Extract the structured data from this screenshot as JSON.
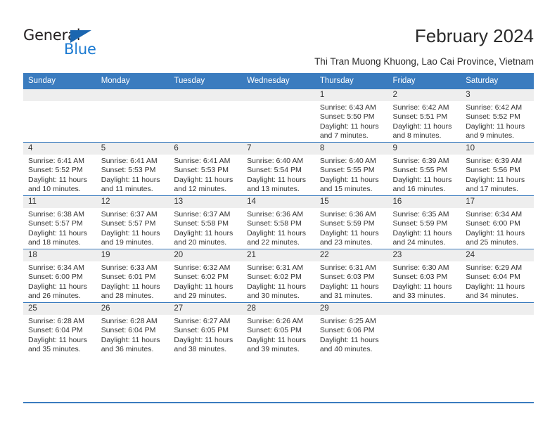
{
  "brand": {
    "name_part1": "General",
    "name_part2": "Blue",
    "triangle_color": "#1b66b0",
    "blue_color": "#1b7ad1"
  },
  "header": {
    "title": "February 2024",
    "subtitle": "Thi Tran Muong Khuong, Lao Cai Province, Vietnam"
  },
  "theme": {
    "header_bar": "#3b7cbf",
    "daynum_shade": "#eeeeee",
    "text": "#333333"
  },
  "weekdays": [
    "Sunday",
    "Monday",
    "Tuesday",
    "Wednesday",
    "Thursday",
    "Friday",
    "Saturday"
  ],
  "weeks": [
    [
      {
        "day": "",
        "sunrise": "",
        "sunset": "",
        "daylight1": "",
        "daylight2": ""
      },
      {
        "day": "",
        "sunrise": "",
        "sunset": "",
        "daylight1": "",
        "daylight2": ""
      },
      {
        "day": "",
        "sunrise": "",
        "sunset": "",
        "daylight1": "",
        "daylight2": ""
      },
      {
        "day": "",
        "sunrise": "",
        "sunset": "",
        "daylight1": "",
        "daylight2": ""
      },
      {
        "day": "1",
        "sunrise": "Sunrise: 6:43 AM",
        "sunset": "Sunset: 5:50 PM",
        "daylight1": "Daylight: 11 hours",
        "daylight2": "and 7 minutes."
      },
      {
        "day": "2",
        "sunrise": "Sunrise: 6:42 AM",
        "sunset": "Sunset: 5:51 PM",
        "daylight1": "Daylight: 11 hours",
        "daylight2": "and 8 minutes."
      },
      {
        "day": "3",
        "sunrise": "Sunrise: 6:42 AM",
        "sunset": "Sunset: 5:52 PM",
        "daylight1": "Daylight: 11 hours",
        "daylight2": "and 9 minutes."
      }
    ],
    [
      {
        "day": "4",
        "sunrise": "Sunrise: 6:41 AM",
        "sunset": "Sunset: 5:52 PM",
        "daylight1": "Daylight: 11 hours",
        "daylight2": "and 10 minutes."
      },
      {
        "day": "5",
        "sunrise": "Sunrise: 6:41 AM",
        "sunset": "Sunset: 5:53 PM",
        "daylight1": "Daylight: 11 hours",
        "daylight2": "and 11 minutes."
      },
      {
        "day": "6",
        "sunrise": "Sunrise: 6:41 AM",
        "sunset": "Sunset: 5:53 PM",
        "daylight1": "Daylight: 11 hours",
        "daylight2": "and 12 minutes."
      },
      {
        "day": "7",
        "sunrise": "Sunrise: 6:40 AM",
        "sunset": "Sunset: 5:54 PM",
        "daylight1": "Daylight: 11 hours",
        "daylight2": "and 13 minutes."
      },
      {
        "day": "8",
        "sunrise": "Sunrise: 6:40 AM",
        "sunset": "Sunset: 5:55 PM",
        "daylight1": "Daylight: 11 hours",
        "daylight2": "and 15 minutes."
      },
      {
        "day": "9",
        "sunrise": "Sunrise: 6:39 AM",
        "sunset": "Sunset: 5:55 PM",
        "daylight1": "Daylight: 11 hours",
        "daylight2": "and 16 minutes."
      },
      {
        "day": "10",
        "sunrise": "Sunrise: 6:39 AM",
        "sunset": "Sunset: 5:56 PM",
        "daylight1": "Daylight: 11 hours",
        "daylight2": "and 17 minutes."
      }
    ],
    [
      {
        "day": "11",
        "sunrise": "Sunrise: 6:38 AM",
        "sunset": "Sunset: 5:57 PM",
        "daylight1": "Daylight: 11 hours",
        "daylight2": "and 18 minutes."
      },
      {
        "day": "12",
        "sunrise": "Sunrise: 6:37 AM",
        "sunset": "Sunset: 5:57 PM",
        "daylight1": "Daylight: 11 hours",
        "daylight2": "and 19 minutes."
      },
      {
        "day": "13",
        "sunrise": "Sunrise: 6:37 AM",
        "sunset": "Sunset: 5:58 PM",
        "daylight1": "Daylight: 11 hours",
        "daylight2": "and 20 minutes."
      },
      {
        "day": "14",
        "sunrise": "Sunrise: 6:36 AM",
        "sunset": "Sunset: 5:58 PM",
        "daylight1": "Daylight: 11 hours",
        "daylight2": "and 22 minutes."
      },
      {
        "day": "15",
        "sunrise": "Sunrise: 6:36 AM",
        "sunset": "Sunset: 5:59 PM",
        "daylight1": "Daylight: 11 hours",
        "daylight2": "and 23 minutes."
      },
      {
        "day": "16",
        "sunrise": "Sunrise: 6:35 AM",
        "sunset": "Sunset: 5:59 PM",
        "daylight1": "Daylight: 11 hours",
        "daylight2": "and 24 minutes."
      },
      {
        "day": "17",
        "sunrise": "Sunrise: 6:34 AM",
        "sunset": "Sunset: 6:00 PM",
        "daylight1": "Daylight: 11 hours",
        "daylight2": "and 25 minutes."
      }
    ],
    [
      {
        "day": "18",
        "sunrise": "Sunrise: 6:34 AM",
        "sunset": "Sunset: 6:00 PM",
        "daylight1": "Daylight: 11 hours",
        "daylight2": "and 26 minutes."
      },
      {
        "day": "19",
        "sunrise": "Sunrise: 6:33 AM",
        "sunset": "Sunset: 6:01 PM",
        "daylight1": "Daylight: 11 hours",
        "daylight2": "and 28 minutes."
      },
      {
        "day": "20",
        "sunrise": "Sunrise: 6:32 AM",
        "sunset": "Sunset: 6:02 PM",
        "daylight1": "Daylight: 11 hours",
        "daylight2": "and 29 minutes."
      },
      {
        "day": "21",
        "sunrise": "Sunrise: 6:31 AM",
        "sunset": "Sunset: 6:02 PM",
        "daylight1": "Daylight: 11 hours",
        "daylight2": "and 30 minutes."
      },
      {
        "day": "22",
        "sunrise": "Sunrise: 6:31 AM",
        "sunset": "Sunset: 6:03 PM",
        "daylight1": "Daylight: 11 hours",
        "daylight2": "and 31 minutes."
      },
      {
        "day": "23",
        "sunrise": "Sunrise: 6:30 AM",
        "sunset": "Sunset: 6:03 PM",
        "daylight1": "Daylight: 11 hours",
        "daylight2": "and 33 minutes."
      },
      {
        "day": "24",
        "sunrise": "Sunrise: 6:29 AM",
        "sunset": "Sunset: 6:04 PM",
        "daylight1": "Daylight: 11 hours",
        "daylight2": "and 34 minutes."
      }
    ],
    [
      {
        "day": "25",
        "sunrise": "Sunrise: 6:28 AM",
        "sunset": "Sunset: 6:04 PM",
        "daylight1": "Daylight: 11 hours",
        "daylight2": "and 35 minutes."
      },
      {
        "day": "26",
        "sunrise": "Sunrise: 6:28 AM",
        "sunset": "Sunset: 6:04 PM",
        "daylight1": "Daylight: 11 hours",
        "daylight2": "and 36 minutes."
      },
      {
        "day": "27",
        "sunrise": "Sunrise: 6:27 AM",
        "sunset": "Sunset: 6:05 PM",
        "daylight1": "Daylight: 11 hours",
        "daylight2": "and 38 minutes."
      },
      {
        "day": "28",
        "sunrise": "Sunrise: 6:26 AM",
        "sunset": "Sunset: 6:05 PM",
        "daylight1": "Daylight: 11 hours",
        "daylight2": "and 39 minutes."
      },
      {
        "day": "29",
        "sunrise": "Sunrise: 6:25 AM",
        "sunset": "Sunset: 6:06 PM",
        "daylight1": "Daylight: 11 hours",
        "daylight2": "and 40 minutes."
      },
      {
        "day": "",
        "sunrise": "",
        "sunset": "",
        "daylight1": "",
        "daylight2": ""
      },
      {
        "day": "",
        "sunrise": "",
        "sunset": "",
        "daylight1": "",
        "daylight2": ""
      }
    ]
  ]
}
